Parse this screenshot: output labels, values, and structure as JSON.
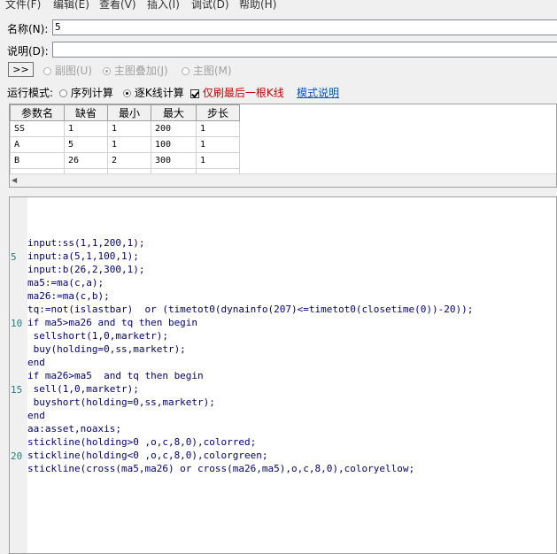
{
  "menubar": [
    "文件(F)",
    "编辑(E)",
    "查看(V)",
    "插入(I)",
    "调试(D)",
    "帮助(H)"
  ],
  "name_field": {
    "label": "名称(N):",
    "value": "5"
  },
  "desc_field": {
    "label": "说明(D):",
    "value": ""
  },
  "expand_button": ">>",
  "chart_options": [
    "副图(U)",
    "主图叠加(J)",
    "主图(M)"
  ],
  "chart_selected": "主图叠加(J)",
  "run_mode": {
    "label": "运行模式:",
    "options": [
      "序列计算",
      "逐K线计算"
    ],
    "selected": "逐K线计算",
    "checkbox_label": "仅刷最后一根K线",
    "checkbox_checked": true,
    "help_link": "模式说明"
  },
  "params": {
    "headers": [
      "参数名",
      "缺省",
      "最小",
      "最大",
      "步长"
    ],
    "rows": [
      [
        "SS",
        "1",
        "1",
        "200",
        "1"
      ],
      [
        "A",
        "5",
        "1",
        "100",
        "1"
      ],
      [
        "B",
        "26",
        "2",
        "300",
        "1"
      ]
    ]
  },
  "editor": {
    "line_numbers": [
      "5",
      "10",
      "15",
      "20"
    ],
    "lines": [
      "input:ss(1,1,200,1);",
      "input:a(5,1,100,1);",
      "input:b(26,2,300,1);",
      "ma5:=ma(c,a);",
      "ma26:=ma(c,b);",
      "tq:=not(islastbar)  or (timetot0(dynainfo(207)<=timetot0(closetime(0))-20));",
      "if ma5>ma26 and tq then begin",
      " sellshort(1,0,marketr);",
      " buy(holding=0,ss,marketr);",
      "end",
      "if ma26>ma5  and tq then begin",
      " sell(1,0,marketr);",
      " buyshort(holding=0,ss,marketr);",
      "end",
      "aa:asset,noaxis;",
      "stickline(holding>0 ,o,c,8,0),colorred;",
      "stickline(holding<0 ,o,c,8,0),colorgreen;",
      "stickline(cross(ma5,ma26) or cross(ma26,ma5),o,c,8,0),coloryellow;"
    ]
  }
}
